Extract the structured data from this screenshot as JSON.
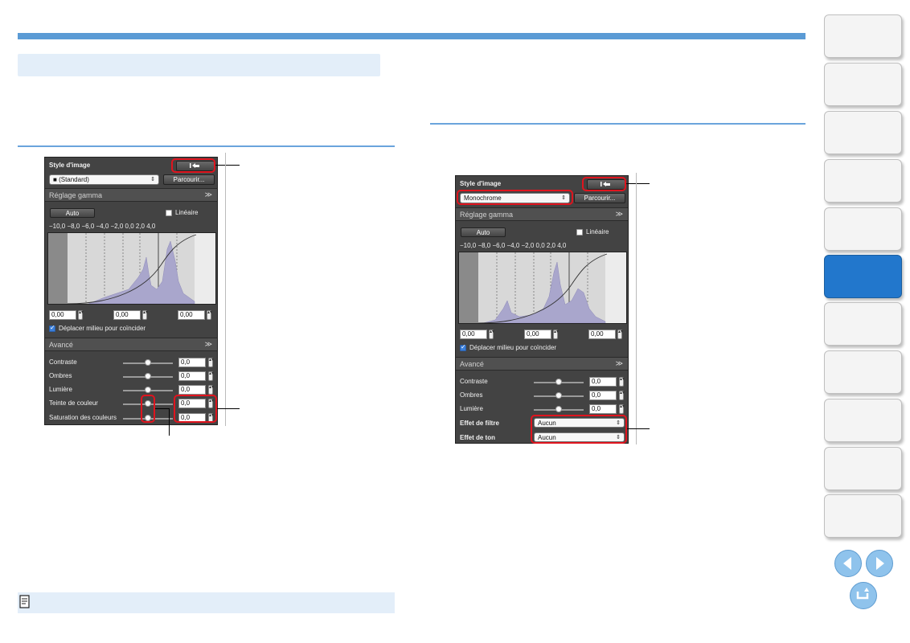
{
  "panel1": {
    "style_label": "Style d'image",
    "style_select": "(Standard)",
    "browse_button": "Parcourir...",
    "gamma_title": "Réglage gamma",
    "auto_button": "Auto",
    "lineaire_label": "Linéaire",
    "tick_labels": "−10,0  −8,0  −6,0  −4,0  −2,0  0,0  2,0  4,0",
    "values": [
      "0,00",
      "0,00",
      "0,00"
    ],
    "deplacer_label": "Déplacer milieu pour coïncider",
    "avance_title": "Avancé",
    "advanced": [
      {
        "label": "Contraste",
        "value": "0,0",
        "knob": 0.5
      },
      {
        "label": "Ombres",
        "value": "0,0",
        "knob": 0.5
      },
      {
        "label": "Lumière",
        "value": "0,0",
        "knob": 0.5
      },
      {
        "label": "Teinte de couleur",
        "value": "0,0",
        "knob": 0.5
      },
      {
        "label": "Saturation des couleurs",
        "value": "0,0",
        "knob": 0.5
      }
    ]
  },
  "panel2": {
    "style_label": "Style d'image",
    "style_select": "Monochrome",
    "browse_button": "Parcourir...",
    "gamma_title": "Réglage gamma",
    "auto_button": "Auto",
    "lineaire_label": "Linéaire",
    "tick_labels": "−10,0  −8,0  −6,0  −4,0  −2,0  0,0  2,0  4,0",
    "values": [
      "0,00",
      "0,00",
      "0,00"
    ],
    "deplacer_label": "Déplacer milieu pour coïncider",
    "avance_title": "Avancé",
    "advanced": [
      {
        "label": "Contraste",
        "value": "0,0",
        "knob": 0.5
      },
      {
        "label": "Ombres",
        "value": "0,0",
        "knob": 0.5
      },
      {
        "label": "Lumière",
        "value": "0,0",
        "knob": 0.5
      }
    ],
    "filter_label": "Effet de filtre",
    "filter_value": "Aucun",
    "tone_label": "Effet de ton",
    "tone_value": "Aucun"
  },
  "colors": {
    "accent": "#5b9bd5",
    "highlight": "#e0141e",
    "active_tab": "#2277cc"
  },
  "icons": [
    "reset-icon",
    "camera-icon",
    "chevron-down-icon",
    "memo-icon",
    "previous-page-icon",
    "next-page-icon",
    "return-icon"
  ]
}
